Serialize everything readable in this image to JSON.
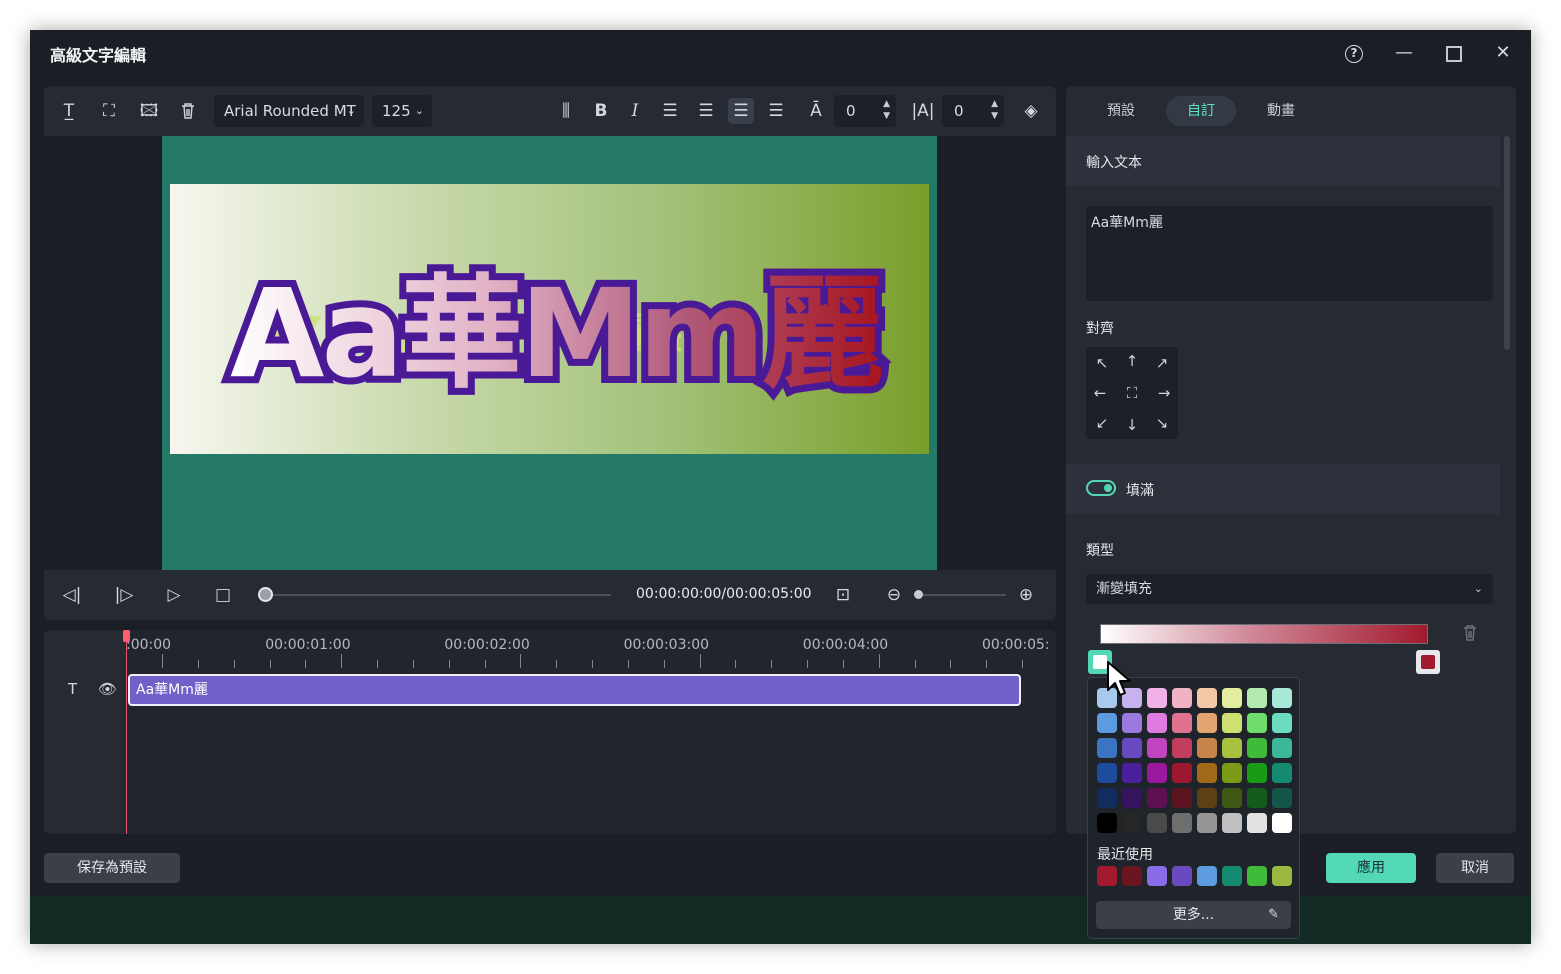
{
  "window": {
    "title": "高級文字編輯"
  },
  "toolbar": {
    "font_family": "Arial Rounded MT",
    "font_size": "125",
    "letter_spacing": "0",
    "line_spacing": "0"
  },
  "preview": {
    "text": "Aa華Mm麗"
  },
  "player": {
    "timecode": "00:00:00:00/00:00:05:00"
  },
  "timeline": {
    "ruler": [
      ":00:00",
      "00:00:01:00",
      "00:00:02:00",
      "00:00:03:00",
      "00:00:04:00",
      "00:00:05:"
    ],
    "clip_label": "Aa華Mm麗"
  },
  "footer": {
    "save_preset": "保存為預設",
    "apply": "應用",
    "cancel": "取消"
  },
  "right_panel": {
    "tabs": [
      "預設",
      "自訂",
      "動畫"
    ],
    "active_tab": "自訂",
    "input_text_heading": "輸入文本",
    "input_text_value": "Aa華Mm麗",
    "align_heading": "對齊",
    "fill_label": "填滿",
    "fill_enabled": true,
    "type_heading": "類型",
    "type_value": "漸變填充",
    "gradient_stops": [
      "#ffffff",
      "#a21a2e"
    ]
  },
  "palette": {
    "grid": [
      [
        "#a9c8ee",
        "#c6b2ee",
        "#efb1e8",
        "#f1b3c4",
        "#f2c8a6",
        "#e2ee9e",
        "#b3eab0",
        "#a8e8d8"
      ],
      [
        "#5c9be0",
        "#9a7ae0",
        "#e07ce0",
        "#e0728f",
        "#e3a470",
        "#cde070",
        "#6fdd6b",
        "#6cdcbe"
      ],
      [
        "#3b74c2",
        "#6a4ac0",
        "#c043c0",
        "#c03d5e",
        "#c8854a",
        "#a8c040",
        "#3fba3a",
        "#3ab898"
      ],
      [
        "#1d4c9c",
        "#4a1f9c",
        "#9c189c",
        "#9c1830",
        "#a06a18",
        "#7c9c18",
        "#189c18",
        "#148a70"
      ],
      [
        "#132c60",
        "#34145c",
        "#5e1052",
        "#5c1420",
        "#5e4014",
        "#3e5814",
        "#145c1c",
        "#14564a"
      ],
      [
        "#000000",
        "#262626",
        "#4a4a4a",
        "#6e6e6e",
        "#969696",
        "#bfbfbf",
        "#e2e2e2",
        "#ffffff"
      ]
    ],
    "recent_label": "最近使用",
    "recent": [
      "#a21a2e",
      "#6a1622",
      "#8a6ce8",
      "#6a4ac0",
      "#5c9be0",
      "#148a70",
      "#3fba3a",
      "#98b840"
    ],
    "more_label": "更多..."
  }
}
